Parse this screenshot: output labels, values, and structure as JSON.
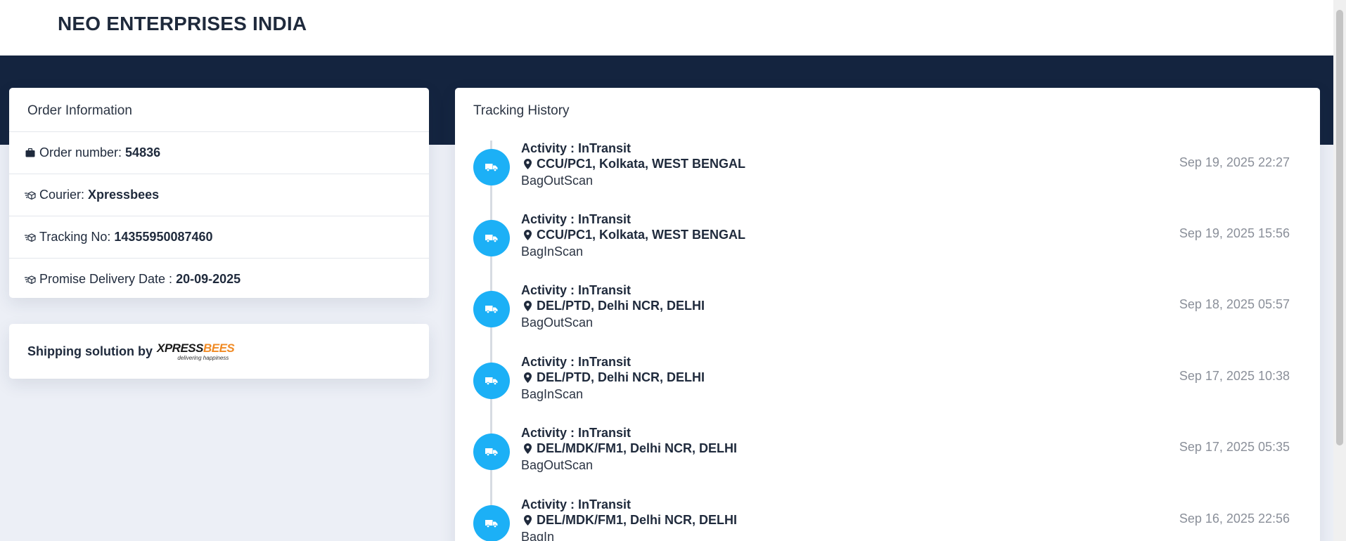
{
  "header": {
    "brand": "NEO ENTERPRISES INDIA"
  },
  "order": {
    "title": "Order Information",
    "rows": [
      {
        "label": "Order number:",
        "value": "54836",
        "icon": "briefcase-icon"
      },
      {
        "label": "Courier:",
        "value": "Xpressbees",
        "icon": "delivery-box-icon"
      },
      {
        "label": "Tracking No:",
        "value": "14355950087460",
        "icon": "delivery-box-icon"
      },
      {
        "label": "Promise Delivery Date :",
        "value": "20-09-2025",
        "icon": "delivery-box-icon"
      }
    ]
  },
  "shipping": {
    "label": "Shipping solution by",
    "logo_main_xp": "XPRESS",
    "logo_main_bees": "BEES",
    "logo_tagline": "delivering happiness"
  },
  "tracking": {
    "title": "Tracking History",
    "events": [
      {
        "activity": "Activity : InTransit",
        "location": "CCU/PC1, Kolkata, WEST BENGAL",
        "status": "BagOutScan",
        "time": "Sep 19, 2025 22:27"
      },
      {
        "activity": "Activity : InTransit",
        "location": "CCU/PC1, Kolkata, WEST BENGAL",
        "status": "BagInScan",
        "time": "Sep 19, 2025 15:56"
      },
      {
        "activity": "Activity : InTransit",
        "location": "DEL/PTD, Delhi NCR, DELHI",
        "status": "BagOutScan",
        "time": "Sep 18, 2025 05:57"
      },
      {
        "activity": "Activity : InTransit",
        "location": "DEL/PTD, Delhi NCR, DELHI",
        "status": "BagInScan",
        "time": "Sep 17, 2025 10:38"
      },
      {
        "activity": "Activity : InTransit",
        "location": "DEL/MDK/FM1, Delhi NCR, DELHI",
        "status": "BagOutScan",
        "time": "Sep 17, 2025 05:35"
      },
      {
        "activity": "Activity : InTransit",
        "location": "DEL/MDK/FM1, Delhi NCR, DELHI",
        "status": "BagIn",
        "time": "Sep 16, 2025 22:56"
      }
    ]
  },
  "colors": {
    "banner": "#14243f",
    "accent": "#1cb0f6",
    "logo_orange": "#f08a24"
  }
}
